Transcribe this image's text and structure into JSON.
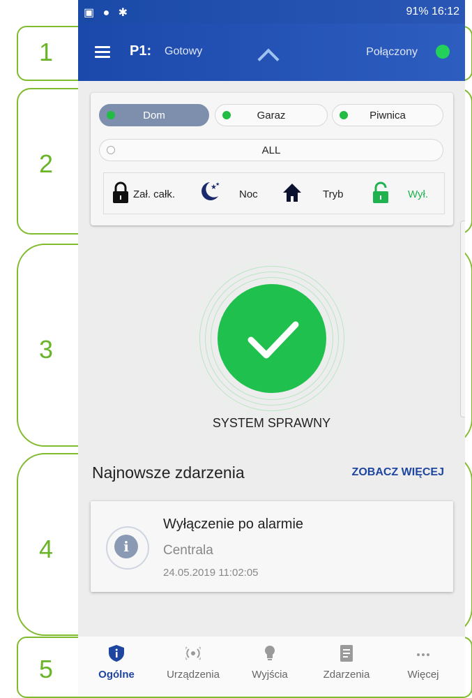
{
  "status_bar": {
    "left_icons": "▣ ● ✱",
    "right_text": "91% 16:12"
  },
  "app_bar": {
    "partition": "P1:",
    "partition_status": "Gotowy",
    "connection": "Połączony",
    "connection_color": "#22d05a"
  },
  "partitions": [
    {
      "label": "Dom",
      "active": true
    },
    {
      "label": "Garaz",
      "active": false
    },
    {
      "label": "Piwnica",
      "active": false
    }
  ],
  "all_label": "ALL",
  "modes": [
    {
      "label": "Zał. całk.",
      "icon": "padlock-closed-icon"
    },
    {
      "label": "Noc",
      "icon": "moon-stars-icon"
    },
    {
      "label": "Tryb",
      "icon": "house-icon"
    },
    {
      "label": "Wył.",
      "icon": "padlock-open-icon",
      "color": "#1fb24e"
    }
  ],
  "system_status": {
    "text": "SYSTEM SPRAWNY",
    "color": "#1fc04e"
  },
  "events": {
    "title": "Najnowsze zdarzenia",
    "more": "ZOBACZ WIĘCEJ",
    "items": [
      {
        "title": "Wyłączenie po alarmie",
        "source": "Centrala",
        "time": "24.05.2019 11:02:05"
      }
    ]
  },
  "nav": [
    {
      "label": "Ogólne",
      "icon": "shield-icon",
      "active": true
    },
    {
      "label": "Urządzenia",
      "icon": "sensor-icon",
      "active": false
    },
    {
      "label": "Wyjścia",
      "icon": "bulb-icon",
      "active": false
    },
    {
      "label": "Zdarzenia",
      "icon": "document-icon",
      "active": false
    },
    {
      "label": "Więcej",
      "icon": "more-icon",
      "active": false
    }
  ],
  "annotations": [
    "1",
    "2",
    "3",
    "4",
    "5"
  ],
  "accent_color": "#1e46a0"
}
